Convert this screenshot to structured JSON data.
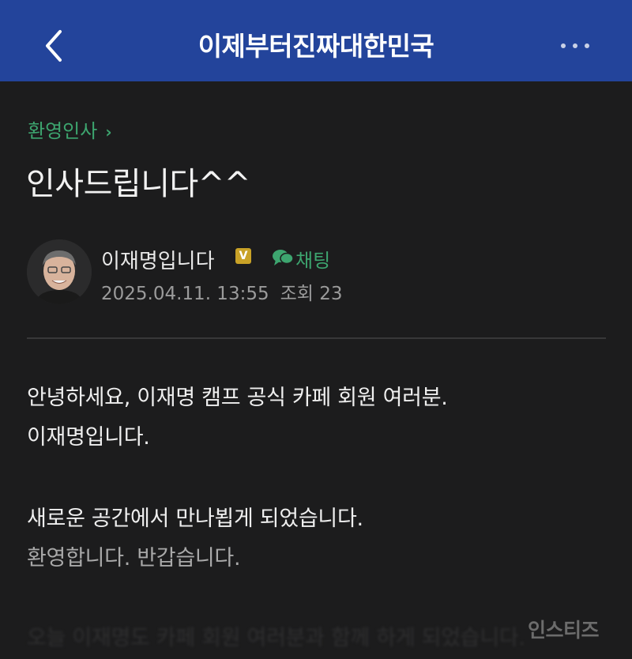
{
  "header": {
    "title": "이제부터진짜대한민국",
    "background_color": "#23449b",
    "back_icon": "chevron-left-icon",
    "more_icon": "more-horizontal-icon"
  },
  "breadcrumb": {
    "label": "환영인사",
    "chevron": "›",
    "color": "#3da56f"
  },
  "post": {
    "title": "인사드립니다^^",
    "author": {
      "name": "이재명입니다",
      "badge": "V",
      "badge_color": "#c9a227",
      "avatar": "profile-photo"
    },
    "chat": {
      "label": "채팅",
      "icon": "chat-bubble-icon"
    },
    "date": "2025.04.11. 13:55",
    "views": "조회 23",
    "body": [
      "안녕하세요, 이재명 캠프 공식 카페 회원 여러분.",
      "이재명입니다.",
      "새로운 공간에서 만나뵙게 되었습니다.",
      "환영합니다. 반갑습니다.",
      "오늘 이재명도 카페 회원 여러분과 함께 하게 되었습니다."
    ]
  },
  "watermark": "인스티즈"
}
